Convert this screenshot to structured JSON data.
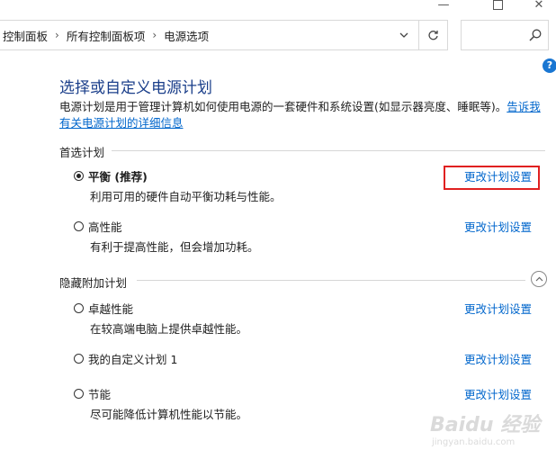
{
  "window": {
    "minimize": "—",
    "close": "✕"
  },
  "address": {
    "crumbs": [
      "控制面板",
      "所有控制面板项",
      "电源选项"
    ]
  },
  "search": {
    "placeholder": ""
  },
  "page": {
    "title": "选择或自定义电源计划",
    "desc_text": "电源计划是用于管理计算机如何使用电源的一套硬件和系统设置(如显示器亮度、睡眠等)。",
    "desc_link": "告诉我有关电源计划的详细信息"
  },
  "preferred": {
    "header": "首选计划",
    "plans": [
      {
        "name": "平衡 (推荐)",
        "desc": "利用可用的硬件自动平衡功耗与性能。",
        "link": "更改计划设置",
        "selected": true
      },
      {
        "name": "高性能",
        "desc": "有利于提高性能，但会增加功耗。",
        "link": "更改计划设置",
        "selected": false
      }
    ]
  },
  "hidden": {
    "header": "隐藏附加计划",
    "plans": [
      {
        "name": "卓越性能",
        "desc": "在较高端电脑上提供卓越性能。",
        "link": "更改计划设置",
        "selected": false
      },
      {
        "name": "我的自定义计划 1",
        "desc": "",
        "link": "更改计划设置",
        "selected": false
      },
      {
        "name": "节能",
        "desc": "尽可能降低计算机性能以节能。",
        "link": "更改计划设置",
        "selected": false
      }
    ]
  },
  "watermark": {
    "logo": "Baidu 经验",
    "url": "jingyan.baidu.com"
  },
  "colors": {
    "link": "#0066cc",
    "title": "#1a3e8a",
    "highlight": "#e02020",
    "help": "#1976d2"
  }
}
